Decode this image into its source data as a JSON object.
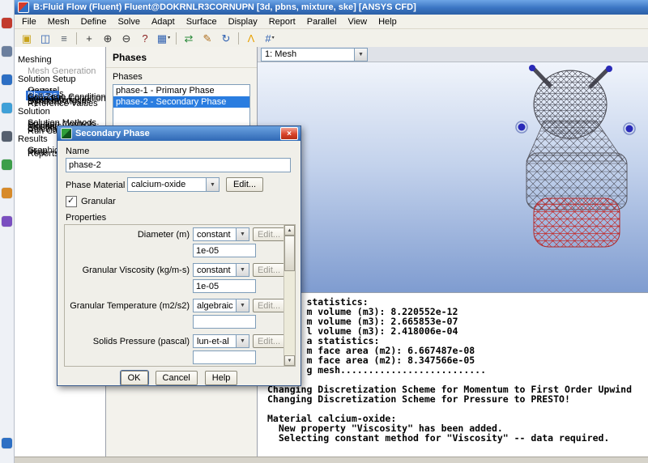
{
  "taskbar": {
    "icons": [
      {
        "name": "taskbar-app-icon-1",
        "color": "#c23b2e"
      },
      {
        "name": "taskbar-app-icon-2",
        "color": "#6b7f9e"
      },
      {
        "name": "taskbar-app-icon-3",
        "color": "#2d6fc4"
      },
      {
        "name": "taskbar-app-icon-4",
        "color": "#3fa0d8"
      },
      {
        "name": "taskbar-app-icon-5",
        "color": "#555f6e"
      },
      {
        "name": "taskbar-app-icon-6",
        "color": "#3c9e4a"
      },
      {
        "name": "taskbar-app-icon-7",
        "color": "#d78a2a"
      },
      {
        "name": "taskbar-app-icon-8",
        "color": "#7a4fc0"
      },
      {
        "name": "taskbar-app-icon-9",
        "color": "#2d6fc4",
        "bottom": true
      }
    ]
  },
  "window": {
    "title": "B:Fluid Flow (Fluent) Fluent@DOKRNLR3CORNUPN  [3d, pbns, mixture, ske] [ANSYS CFD]"
  },
  "menubar": {
    "items": [
      "File",
      "Mesh",
      "Define",
      "Solve",
      "Adapt",
      "Surface",
      "Display",
      "Report",
      "Parallel",
      "View",
      "Help"
    ]
  },
  "toolbar": {
    "items": [
      {
        "name": "open-icon",
        "glyph": "▣",
        "color": "#c8a21a"
      },
      {
        "name": "save-icon",
        "glyph": "◫",
        "color": "#2d5fb0"
      },
      {
        "name": "print-icon",
        "glyph": "≡",
        "color": "#5a6470"
      },
      {
        "sep": true
      },
      {
        "name": "pan-icon",
        "glyph": "+",
        "color": "#333333"
      },
      {
        "name": "zoom-in-icon",
        "glyph": "⊕",
        "color": "#333333"
      },
      {
        "name": "zoom-out-icon",
        "glyph": "⊖",
        "color": "#333333"
      },
      {
        "name": "probe-icon",
        "glyph": "?",
        "color": "#8a2020"
      },
      {
        "name": "display-options-icon",
        "glyph": "▦",
        "color": "#2d5fb0",
        "arrow": true
      },
      {
        "sep": true
      },
      {
        "name": "swap-views-icon",
        "glyph": "⇄",
        "color": "#2a8a3a"
      },
      {
        "name": "edit-icon",
        "glyph": "✎",
        "color": "#b07020"
      },
      {
        "name": "refresh-icon",
        "glyph": "↻",
        "color": "#2d5fb0"
      },
      {
        "sep": true
      },
      {
        "name": "ansys-logo-icon",
        "glyph": "Λ",
        "color": "#e8a000"
      },
      {
        "name": "hex-grid-icon",
        "glyph": "#",
        "color": "#2d5fb0",
        "arrow": true
      }
    ]
  },
  "nav_tree": {
    "sections": [
      {
        "label": "Meshing",
        "items": [
          {
            "label": "Mesh Generation",
            "disabled": true
          }
        ]
      },
      {
        "label": "Solution Setup",
        "items": [
          {
            "label": "General"
          },
          {
            "label": "Models"
          },
          {
            "label": "Materials"
          },
          {
            "label": "Phases",
            "selected": true
          },
          {
            "label": "Cell Zone Conditions"
          },
          {
            "label": "Boundary Conditions"
          },
          {
            "label": "Mesh Interfaces"
          },
          {
            "label": "Dynamic Mesh"
          },
          {
            "label": "Reference Values"
          }
        ]
      },
      {
        "label": "Solution",
        "items": [
          {
            "label": "Solution Methods"
          },
          {
            "label": "Solution Controls"
          },
          {
            "label": "Monitors"
          },
          {
            "label": "Solution Initialization"
          },
          {
            "label": "Calculation Activities"
          },
          {
            "label": "Run Calculation"
          }
        ]
      },
      {
        "label": "Results",
        "items": [
          {
            "label": "Graphics and Animations"
          },
          {
            "label": "Plots"
          },
          {
            "label": "Reports"
          }
        ]
      }
    ]
  },
  "phases_panel": {
    "title": "Phases",
    "list_label": "Phases",
    "items": [
      {
        "label": "phase-1 - Primary Phase",
        "selected": false
      },
      {
        "label": "phase-2 - Secondary Phase",
        "selected": true
      }
    ]
  },
  "graphics": {
    "view_selector": "1: Mesh"
  },
  "console": {
    "lines": [
      "       statistics:",
      "       m volume (m3): 8.220552e-12",
      "       m volume (m3): 2.665853e-07",
      "       l volume (m3): 2.418006e-04",
      "       a statistics:",
      "       m face area (m2): 6.667487e-08",
      "       m face area (m2): 8.347566e-05",
      "       g mesh..........................",
      "",
      "Changing Discretization Scheme for Momentum to First Order Upwind",
      "Changing Discretization Scheme for Pressure to PRESTO!",
      "",
      "Material calcium-oxide:",
      "  New property \"Viscosity\" has been added.",
      "  Selecting constant method for \"Viscosity\" -- data required."
    ]
  },
  "dialog": {
    "title": "Secondary Phase",
    "name_label": "Name",
    "name_value": "phase-2",
    "phase_material_label": "Phase Material",
    "phase_material_value": "calcium-oxide",
    "phase_material_edit_label": "Edit...",
    "granular_label": "Granular",
    "granular_checked": true,
    "properties_label": "Properties",
    "properties": [
      {
        "label": "Diameter (m)",
        "method": "constant",
        "value": "1e-05",
        "edit_label": "Edit...",
        "edit_disabled": true
      },
      {
        "label": "Granular Viscosity (kg/m-s)",
        "method": "constant",
        "value": "1e-05",
        "edit_label": "Edit...",
        "edit_disabled": true
      },
      {
        "label": "Granular Temperature (m2/s2)",
        "method": "algebraic",
        "value": "",
        "edit_label": "Edit...",
        "edit_disabled": true
      },
      {
        "label": "Solids Pressure (pascal)",
        "method": "lun-et-al",
        "value": "",
        "edit_label": "Edit...",
        "edit_disabled": true
      }
    ],
    "ok_label": "OK",
    "cancel_label": "Cancel",
    "help_label": "Help"
  }
}
